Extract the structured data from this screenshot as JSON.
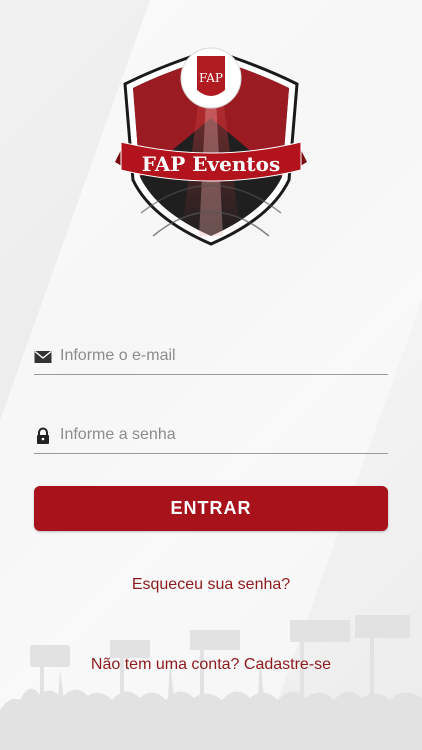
{
  "brand": {
    "name": "FAP Eventos",
    "monogram": "FAP",
    "colors": {
      "primary": "#a8121b",
      "link": "#8e1a1d",
      "shield_dark": "#1e1e1e"
    }
  },
  "login": {
    "email": {
      "icon": "envelope-icon",
      "placeholder": "Informe o e-mail",
      "value": ""
    },
    "password": {
      "icon": "lock-icon",
      "placeholder": "Informe a senha",
      "value": ""
    },
    "submit_label": "ENTRAR",
    "forgot_label": "Esqueceu sua senha?",
    "signup_prompt": "Não tem uma conta?",
    "signup_link": "Cadastre-se"
  }
}
